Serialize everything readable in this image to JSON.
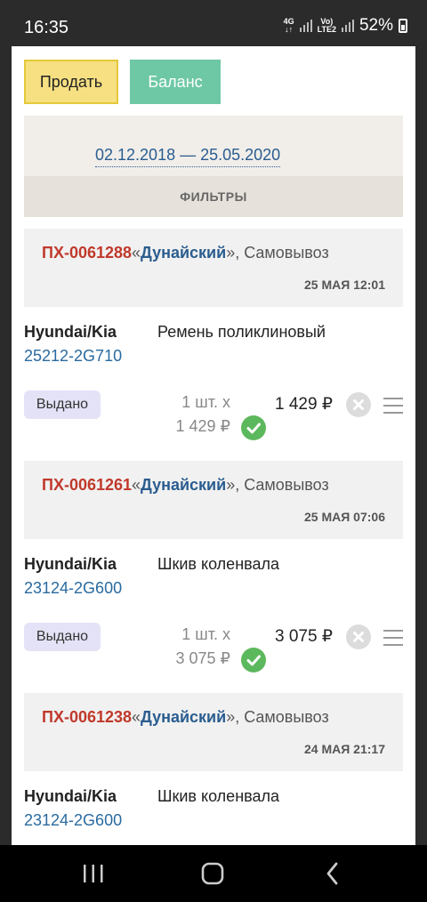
{
  "status_bar": {
    "time": "16:35",
    "network_top": "4G",
    "volte_top": "Vo)",
    "volte_bottom": "LTE2",
    "battery": "52%"
  },
  "actions": {
    "sell_label": "Продать",
    "balance_label": "Баланс"
  },
  "filter": {
    "date_range": "02.12.2018 — 25.05.2020",
    "filters_label": "ФИЛЬТРЫ"
  },
  "orders": [
    {
      "id": "ПХ-0061288",
      "open_quote": "«",
      "shop": "Дунайский",
      "delivery": "», Самовывоз",
      "date": "25 МАЯ 12:01",
      "brand": "Hyundai/Kia",
      "article": "25212-2G710",
      "name": "Ремень поликлиновый",
      "status": "Выдано",
      "qty": "1 шт. x",
      "unit_price": "1 429 ₽",
      "total": "1 429 ₽"
    },
    {
      "id": "ПХ-0061261",
      "open_quote": "«",
      "shop": "Дунайский",
      "delivery": "», Самовывоз",
      "date": "25 МАЯ 07:06",
      "brand": "Hyundai/Kia",
      "article": "23124-2G600",
      "name": "Шкив коленвала",
      "status": "Выдано",
      "qty": "1 шт. x",
      "unit_price": "3 075 ₽",
      "total": "3 075 ₽"
    },
    {
      "id": "ПХ-0061238",
      "open_quote": "«",
      "shop": "Дунайский",
      "delivery": "», Самовывоз",
      "date": "24 МАЯ 21:17",
      "brand": "Hyundai/Kia",
      "article": "23124-2G600",
      "name": "Шкив коленвала"
    }
  ],
  "colors": {
    "accent_sell": "#f6e082",
    "accent_balance": "#6ec8a5",
    "order_id": "#c0392b",
    "link": "#2a6a9f",
    "status_ok": "#5cb85c"
  }
}
